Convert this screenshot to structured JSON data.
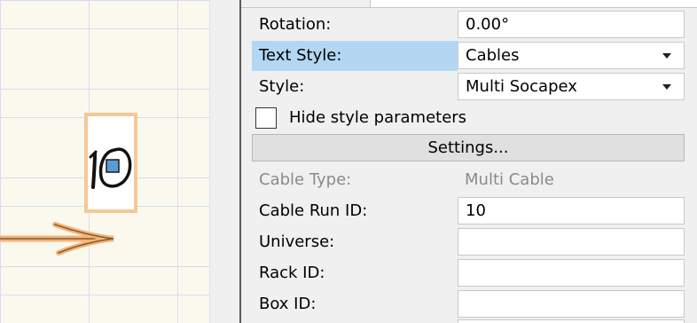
{
  "canvas": {
    "label_text": "10",
    "grid_color": "#cfdced",
    "background_color": "#fbf9ee",
    "label_border_color": "#f5c898",
    "cable_color": "#f0b070",
    "marker_color": "#5b9bd5"
  },
  "properties": {
    "rotation": {
      "label": "Rotation:",
      "value": "0.00°"
    },
    "text_style": {
      "label": "Text Style:",
      "value": "Cables",
      "highlight_color": "#b3d7f3"
    },
    "style": {
      "label": "Style:",
      "value": "Multi Socapex"
    },
    "hide_style_params": {
      "label": "Hide style parameters",
      "checked": false
    },
    "settings_button": {
      "label": "Settings..."
    },
    "cable_type": {
      "label": "Cable Type:",
      "value": "Multi Cable"
    },
    "cable_run_id": {
      "label": "Cable Run ID:",
      "value": "10"
    },
    "universe": {
      "label": "Universe:",
      "value": ""
    },
    "rack_id": {
      "label": "Rack ID:",
      "value": ""
    },
    "box_id": {
      "label": "Box ID:",
      "value": ""
    }
  }
}
